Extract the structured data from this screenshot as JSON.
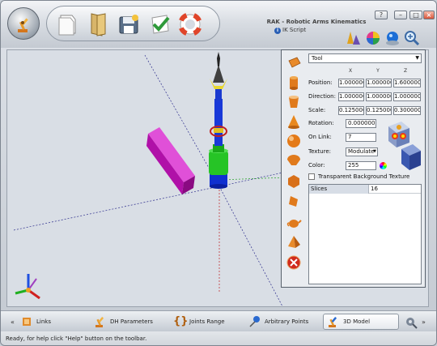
{
  "window": {
    "title": "RAK - Robotic Arms Kinematics",
    "subtitle": "IK Script"
  },
  "toolbar": {
    "buttons": [
      "new-icon",
      "open-icon",
      "save-icon",
      "check-icon",
      "help-lifebuoy-icon"
    ]
  },
  "view_icons": [
    "cone-shapes-icon",
    "color-wheel-icon",
    "sphere-icon",
    "zoom-icon"
  ],
  "panel": {
    "object_select": "Tool",
    "columns": [
      "X",
      "Y",
      "Z"
    ],
    "position": {
      "label": "Position:",
      "x": "1.000000",
      "y": "1.000000",
      "z": "1.600000"
    },
    "direction": {
      "label": "Direction:",
      "x": "1.000000",
      "y": "1.000000",
      "z": "1.000000"
    },
    "scale": {
      "label": "Scale:",
      "x": "0.125000",
      "y": "0.125000",
      "z": "0.300000"
    },
    "rotation": {
      "label": "Rotation:",
      "value": "0.000000"
    },
    "on_link": {
      "label": "On Link:",
      "value": "7"
    },
    "texture": {
      "label": "Texture:",
      "value": "Modulate"
    },
    "color": {
      "label": "Color:",
      "value": "255"
    },
    "transparent_bg": {
      "label": "Transparent Background Texture",
      "checked": false
    },
    "grid": [
      {
        "key": "Slices",
        "value": "16"
      }
    ],
    "shape_buttons": [
      "cube-icon",
      "cylinder-icon",
      "cup-icon",
      "cone-icon",
      "sphere-icon",
      "dome-icon",
      "dodecahedron-icon",
      "shard-icon",
      "teapot-icon",
      "pyramid-icon",
      "delete-icon"
    ]
  },
  "tabs": [
    {
      "label": "Links",
      "icon": "links-icon",
      "active": false
    },
    {
      "label": "DH Parameters",
      "icon": "robot-arm-icon",
      "active": false
    },
    {
      "label": "Joints Range",
      "icon": "braces-icon",
      "active": false
    },
    {
      "label": "Arbitrary Points",
      "icon": "pushpin-icon",
      "active": false
    },
    {
      "label": "3D Model",
      "icon": "robot-3d-icon",
      "active": true
    }
  ],
  "status": "Ready, for help click \"Help\" button on the toolbar.",
  "colors": {
    "accent": "#2a5fb5",
    "magenta_box": "#c010b8",
    "tool_blue": "#1030d0",
    "tool_green": "#20c020"
  }
}
